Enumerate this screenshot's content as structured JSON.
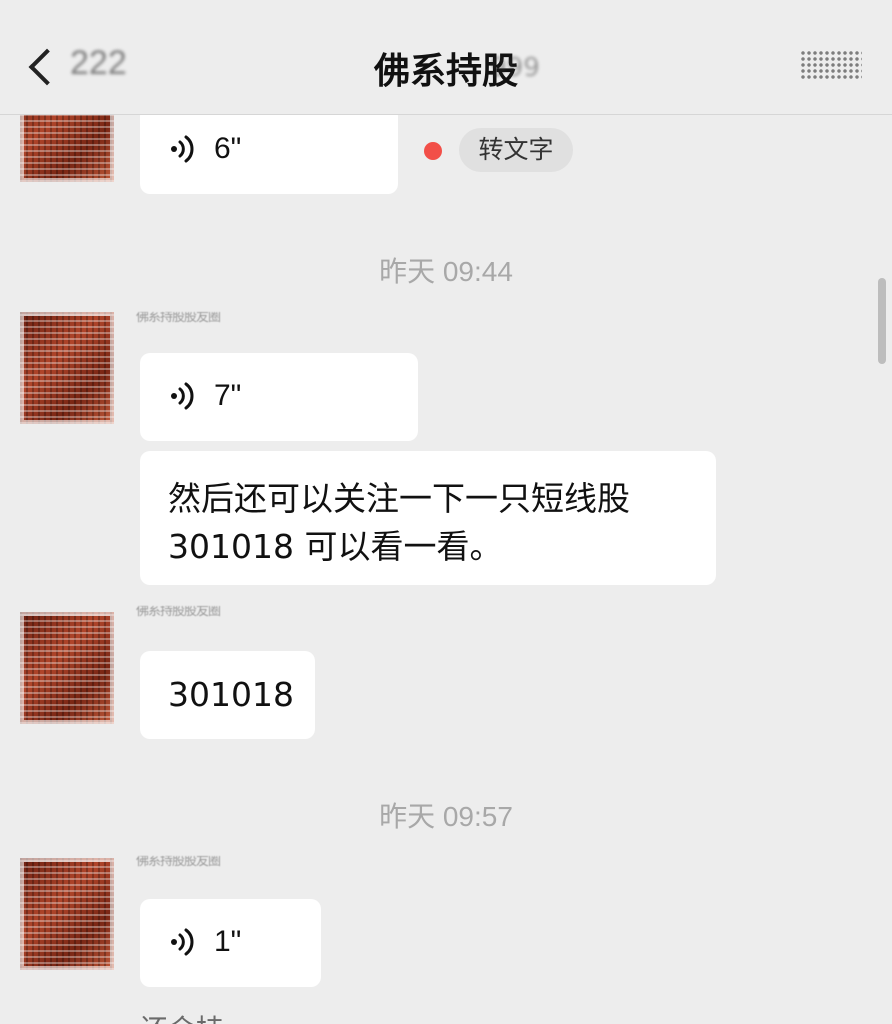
{
  "header": {
    "back_count": "222",
    "title": "佛系持股",
    "title_badge": "999"
  },
  "messages": {
    "m1": {
      "duration": "6\"",
      "transcribe_label": "转文字"
    },
    "ts1": "昨天 09:44",
    "m2": {
      "duration": "7\""
    },
    "m3": {
      "line1": "然后还可以关注一下一只短线股",
      "line2": "301018 可以看一看。"
    },
    "m4": {
      "text": "301018"
    },
    "ts2": "昨天 09:57",
    "m5": {
      "duration": "1\""
    },
    "nickname": "佛系持股股友圈"
  },
  "footer": {
    "partial_text": "还会持",
    "watermark": ""
  },
  "colors": {
    "background": "#ededed",
    "bubble": "#ffffff",
    "unread_dot": "#f24f48",
    "timestamp": "#a8a8a8"
  },
  "icons": {
    "back": "chevron-left-icon",
    "more": "more-icon",
    "voice": "voice-wave-icon"
  }
}
